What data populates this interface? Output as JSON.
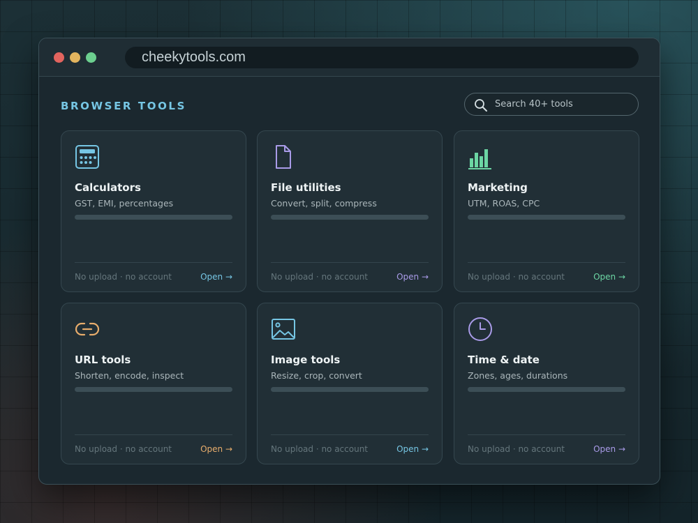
{
  "browser": {
    "url": "cheekytools.com"
  },
  "page": {
    "section_title": "BROWSER TOOLS",
    "search_placeholder": "Search 40+ tools"
  },
  "colors": {
    "blue": "#76c6e4",
    "purple": "#a99be8",
    "green": "#6cd6a4",
    "orange": "#e8ad6c"
  },
  "cards": [
    {
      "title": "Calculators",
      "subtitle": "GST, EMI, percentages",
      "footer": "No upload · no account",
      "link": "Open →",
      "icon": "calculator-icon",
      "accent": "#76c6e4"
    },
    {
      "title": "File utilities",
      "subtitle": "Convert, split, compress",
      "footer": "No upload · no account",
      "link": "Open →",
      "icon": "file-icon",
      "accent": "#a99be8"
    },
    {
      "title": "Marketing",
      "subtitle": "UTM, ROAS, CPC",
      "footer": "No upload · no account",
      "link": "Open →",
      "icon": "bar-chart-icon",
      "accent": "#6cd6a4"
    },
    {
      "title": "URL tools",
      "subtitle": "Shorten, encode, inspect",
      "footer": "No upload · no account",
      "link": "Open →",
      "icon": "link-icon",
      "accent": "#e8ad6c"
    },
    {
      "title": "Image tools",
      "subtitle": "Resize, crop, convert",
      "footer": "No upload · no account",
      "link": "Open →",
      "icon": "image-icon",
      "accent": "#76c6e4"
    },
    {
      "title": "Time & date",
      "subtitle": "Zones, ages, durations",
      "footer": "No upload · no account",
      "link": "Open →",
      "icon": "clock-icon",
      "accent": "#a99be8"
    }
  ]
}
